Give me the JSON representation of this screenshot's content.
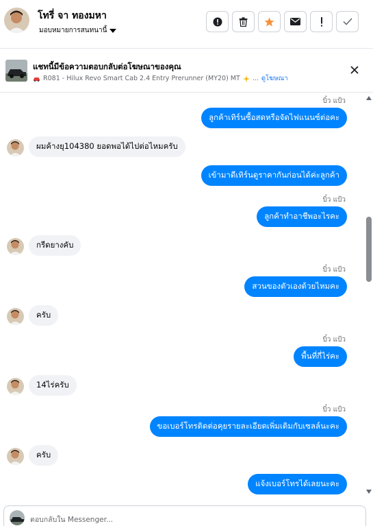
{
  "header": {
    "contact_name": "โทรี่ จา ทองมหา",
    "assign_label": "มอบหมายการสนทนานี้",
    "actions": [
      {
        "icon": "alert-circle-icon",
        "label": "spam"
      },
      {
        "icon": "trash-icon",
        "label": "delete"
      },
      {
        "icon": "star-icon",
        "label": "follow-up"
      },
      {
        "icon": "envelope-icon",
        "label": "unread"
      },
      {
        "icon": "exclamation-icon",
        "label": "important"
      },
      {
        "icon": "check-icon",
        "label": "done"
      }
    ]
  },
  "ad_banner": {
    "title": "แชทนี้มีข้อความตอบกลับต่อโฆษณาของคุณ",
    "ad_text": "R081 - Hilux Revo Smart Cab 2.4 Entry Prerunner (MY20) MT",
    "ellipsis": "...",
    "view_ad_link": "ดูโฆษณา"
  },
  "messages": [
    {
      "dir": "out",
      "sender": "บิ๋ว แป้ว",
      "text": "ลูกค้าเทิร์นซื้อสดหรือจัดไฟแนนซ์ต่อคะ"
    },
    {
      "dir": "in",
      "text": "ผมค้างยุ104380 ยอดพอได้ไปต่อไหมครับ"
    },
    {
      "dir": "out",
      "sender": "",
      "text": "เข้ามาดีเทิร์นดูราคากันก่อนได้ค่ะลูกค้า"
    },
    {
      "dir": "out",
      "sender": "บิ๋ว แป้ว",
      "text": "ลูกค้าทำอาชีพอะไรคะ"
    },
    {
      "dir": "in",
      "text": "กรีดยางคับ"
    },
    {
      "dir": "out",
      "sender": "บิ๋ว แป้ว",
      "text": "สวนของตัวเองด้วยไหมคะ"
    },
    {
      "dir": "in",
      "text": "ครับ"
    },
    {
      "dir": "out",
      "sender": "บิ๋ว แป้ว",
      "text": "พื้นที่กี่ไร่คะ"
    },
    {
      "dir": "in",
      "text": "14ไร่ครับ"
    },
    {
      "dir": "out",
      "sender": "บิ๋ว แป้ว",
      "text": "ขอเบอร์โทรติดต่อคุยรายละเอียดเพิ่มเติมกับเซลล์นะคะ"
    },
    {
      "dir": "in",
      "text": "ครับ"
    },
    {
      "dir": "out",
      "sender": "",
      "text": "แจ้งเบอร์โทรได้เลยนะคะ"
    }
  ],
  "composer": {
    "placeholder": "ตอบกลับใน Messenger..."
  },
  "colors": {
    "outgoing_bubble": "#0084ff",
    "incoming_bubble": "#f0f2f5",
    "star": "#f7923b",
    "link": "#1877f2"
  }
}
